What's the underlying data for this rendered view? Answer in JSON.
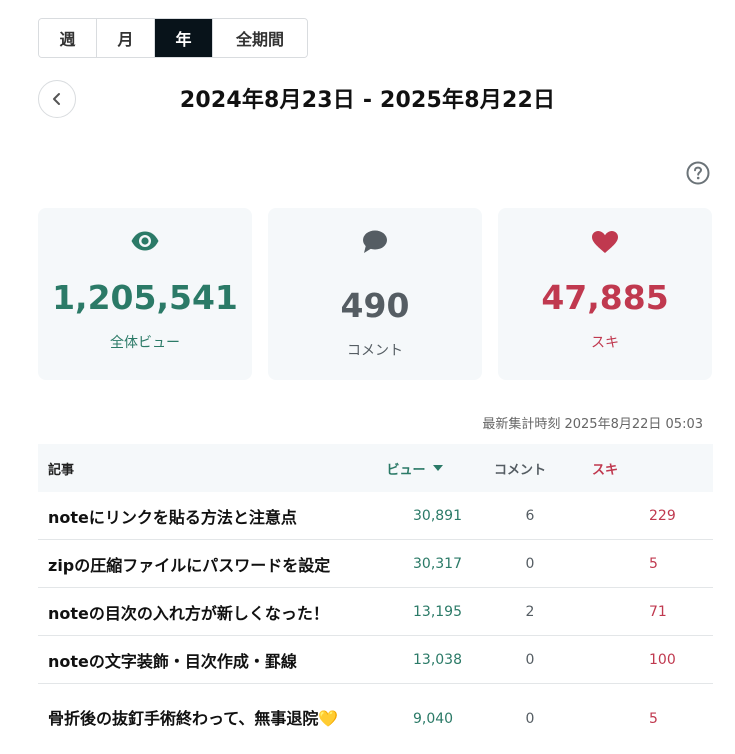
{
  "period_tabs": [
    {
      "label": "週",
      "active": false
    },
    {
      "label": "月",
      "active": false
    },
    {
      "label": "年",
      "active": true
    },
    {
      "label": "全期間",
      "active": false
    }
  ],
  "date_range": "2024年8月23日 - 2025年8月22日",
  "summary": {
    "views": {
      "value": "1,205,541",
      "label": "全体ビュー",
      "icon": "eye-icon"
    },
    "comments": {
      "value": "490",
      "label": "コメント",
      "icon": "speech-bubble-icon"
    },
    "likes": {
      "value": "47,885",
      "label": "スキ",
      "icon": "heart-icon"
    }
  },
  "updated_at": "最新集計時刻 2025年8月22日 05:03",
  "table": {
    "headers": {
      "title": "記事",
      "views": "ビュー",
      "comments": "コメント",
      "likes": "スキ"
    },
    "rows": [
      {
        "title": "noteにリンクを貼る方法と注意点",
        "views": "30,891",
        "comments": "6",
        "likes": "229"
      },
      {
        "title": "zipの圧縮ファイルにパスワードを設定",
        "views": "30,317",
        "comments": "0",
        "likes": "5"
      },
      {
        "title": "noteの目次の入れ方が新しくなった！",
        "views": "13,195",
        "comments": "2",
        "likes": "71"
      },
      {
        "title": "noteの文字装飾・目次作成・罫線",
        "views": "13,038",
        "comments": "0",
        "likes": "100"
      },
      {
        "title": "骨折後の抜釘手術終わって、無事退院💛",
        "views": "9,040",
        "comments": "0",
        "likes": "5"
      }
    ]
  },
  "colors": {
    "views": "#2b7a67",
    "comments": "#555d63",
    "likes": "#c0394f",
    "active_tab": "#08131a"
  }
}
